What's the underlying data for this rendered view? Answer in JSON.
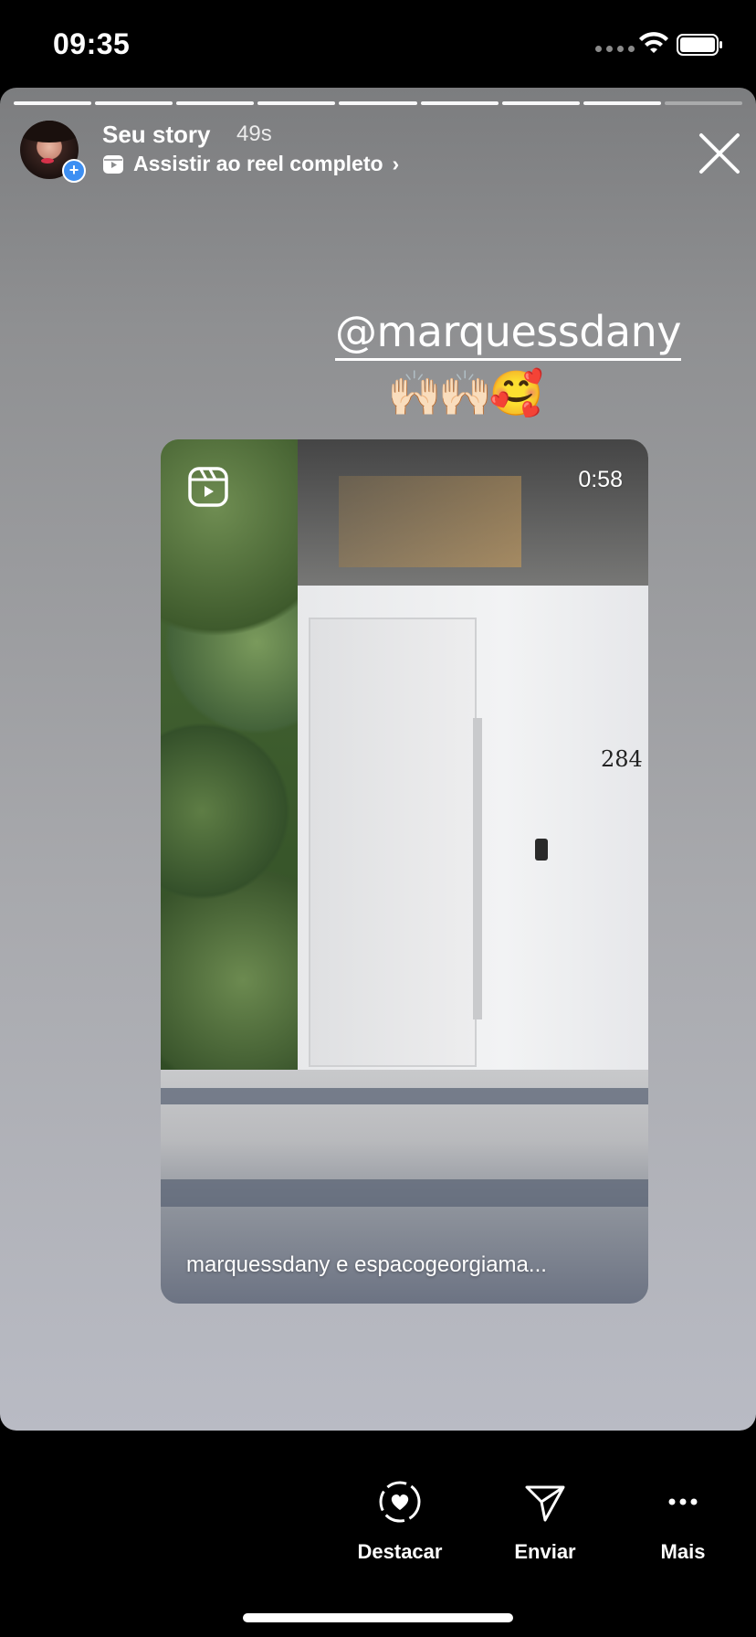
{
  "status_bar": {
    "time": "09:35",
    "icons": [
      "signal-dots-icon",
      "wifi-icon",
      "battery-icon"
    ]
  },
  "story": {
    "progress_segments": 9,
    "owner_label": "Seu story",
    "elapsed": "49s",
    "reel_link_label": "Assistir ao reel completo",
    "mention": "@marquessdany",
    "emojis": "🙌🏻🙌🏻🥰",
    "reel": {
      "duration": "0:58",
      "caption": "marquessdany e espacogeorgiama...",
      "house_number": "284"
    }
  },
  "actions": [
    {
      "label": "Destacar",
      "icon": "highlight-heart-icon"
    },
    {
      "label": "Enviar",
      "icon": "send-icon"
    },
    {
      "label": "Mais",
      "icon": "more-icon"
    }
  ],
  "colors": {
    "background": "#000000",
    "story_gradient_top": "#7c7d7f",
    "story_gradient_bottom": "#b9bbc4",
    "avatar_badge": "#3d8ff2"
  }
}
